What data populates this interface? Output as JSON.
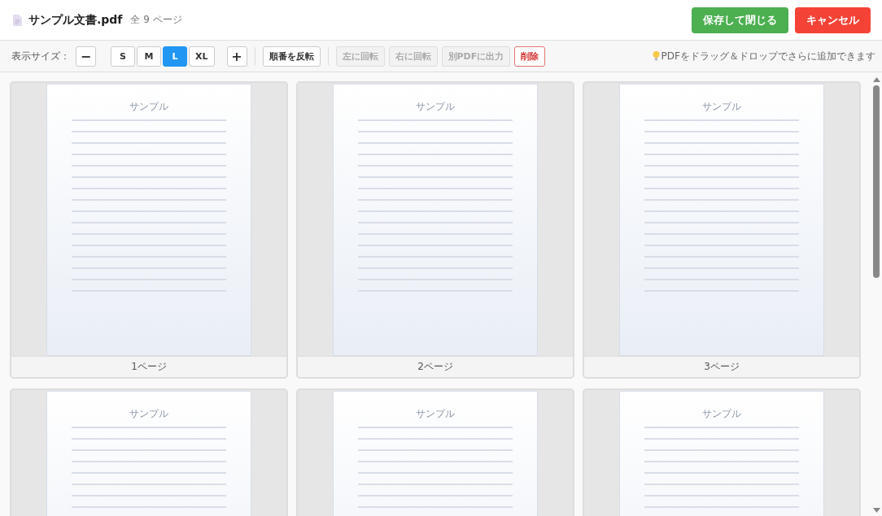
{
  "header": {
    "file_name": "サンプル文書.pdf",
    "page_count": "全 9 ページ",
    "buttons": [
      {
        "label": "保存して閉じる",
        "kind": "save"
      },
      {
        "label": "キャンセル",
        "kind": "cancel"
      }
    ]
  },
  "toolbar": {
    "size_label": "表示サイズ：",
    "zoom_out": "−",
    "zoom_in": "+",
    "sizes": [
      {
        "label": "S",
        "selected": false
      },
      {
        "label": "M",
        "selected": false
      },
      {
        "label": "L",
        "selected": true
      },
      {
        "label": "XL",
        "selected": false
      }
    ],
    "actions": [
      {
        "label": "順番を反転",
        "kind": "normal",
        "disabled": false
      },
      {
        "label": "左に回転",
        "kind": "normal",
        "disabled": true
      },
      {
        "label": "右に回転",
        "kind": "normal",
        "disabled": true
      },
      {
        "label": "別PDFに出力",
        "kind": "normal",
        "disabled": true
      },
      {
        "label": "削除",
        "kind": "danger",
        "disabled": false
      }
    ],
    "hint": "PDFをドラッグ＆ドロップでさらに追加できます"
  },
  "pages": [
    {
      "title": "サンプル",
      "label": "1ページ"
    },
    {
      "title": "サンプル",
      "label": "2ページ"
    },
    {
      "title": "サンプル",
      "label": "3ページ"
    },
    {
      "title": "サンプル"
    },
    {
      "title": "サンプル"
    },
    {
      "title": "サンプル"
    }
  ]
}
